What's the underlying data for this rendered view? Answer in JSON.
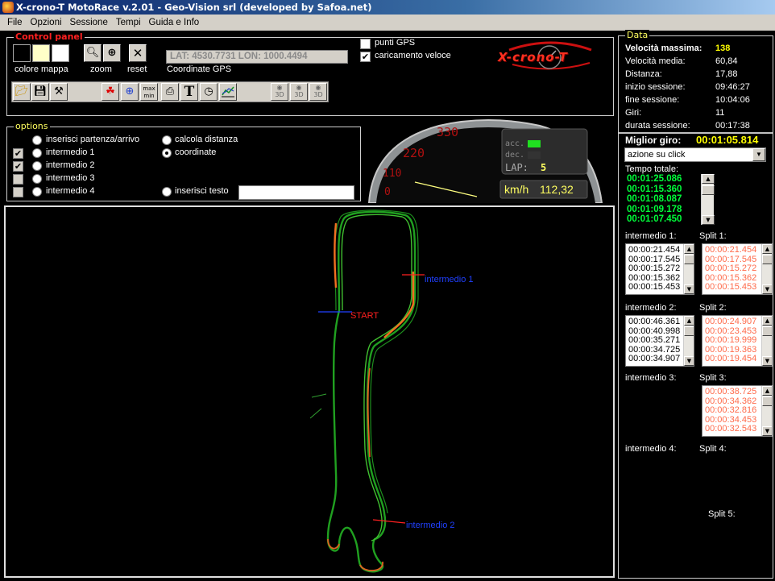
{
  "window": {
    "title": "X-crono-T MotoRace v.2.01 - Geo-Vision srl (developed by Safoa.net)"
  },
  "menu": [
    "File",
    "Opzioni",
    "Sessione",
    "Tempi",
    "Guida e Info"
  ],
  "control_panel": {
    "title": "Control panel",
    "colore_mappa_label": "colore mappa",
    "zoom_label": "zoom",
    "reset_label": "reset",
    "gps_coords": "LAT: 4530.7731 LON: 1000.4494",
    "gps_label": "Coordinate GPS",
    "punti_gps": {
      "label": "punti GPS",
      "checked": false
    },
    "caricamento_veloce": {
      "label": "caricamento veloce",
      "checked": true
    },
    "logo_text": "X-crono-T",
    "toolbar_icons": [
      "open-folder-icon",
      "save-icon",
      "tools-icon",
      "track-icon",
      "target-icon",
      "max-min-icon",
      "print-icon",
      "text-icon",
      "stopwatch-icon",
      "chart-icon",
      "view-3d-icon",
      "view-3d-icon",
      "view-3d-icon"
    ],
    "maxmin_top": "max",
    "maxmin_bottom": "min",
    "text_glyph": "T",
    "three_d": "3D",
    "colors": {
      "swatch1": "#000000",
      "swatch2": "#ffffc8",
      "swatch3": "#ffffff",
      "title": "#ff0000"
    }
  },
  "options": {
    "title": "options",
    "items": [
      {
        "label": "inserisci partenza/arrivo",
        "checkbox": false,
        "radio": false
      },
      {
        "label": "intermedio 1",
        "checkbox": true,
        "radio": false
      },
      {
        "label": "intermedio 2",
        "checkbox": true,
        "radio": false
      },
      {
        "label": "intermedio 3",
        "checkbox": false,
        "radio": false
      },
      {
        "label": "intermedio 4",
        "checkbox": false,
        "radio": false
      }
    ],
    "calcola_distanza": "calcola distanza",
    "coordinate": "coordinate",
    "inserisci_testo": "inserisci testo",
    "testo_value": ""
  },
  "dashboard": {
    "scale_labels": [
      "330",
      "220",
      "110",
      "0"
    ],
    "acc_label": "acc.",
    "dec_label": "dec.",
    "lap_label": "LAP:",
    "lap_value": "5",
    "speed_label": "km/h",
    "speed_value": "112,32"
  },
  "map": {
    "start_label": "START",
    "intermedio1_label": "intermedio 1",
    "intermedio2_label": "intermedio 2"
  },
  "data": {
    "title": "Data",
    "velocita_massima_label": "Velocità massima:",
    "velocita_massima": "138",
    "stats": [
      {
        "label": "Velocità media:",
        "value": "60,84"
      },
      {
        "label": "Distanza:",
        "value": "17,88"
      },
      {
        "label": "inizio sessione:",
        "value": "09:46:27"
      },
      {
        "label": "fine sessione:",
        "value": "10:04:06"
      },
      {
        "label": "Giri:",
        "value": "11"
      },
      {
        "label": "durata sessione:",
        "value": "00:17:38"
      }
    ],
    "miglior_giro_label": "Miglior giro:",
    "miglior_giro": "00:01:05.814",
    "azione": "azione su click",
    "tempo_totale_label": "Tempo totale:",
    "tempo_totale": [
      "00:01:25.086",
      "00:01:15.360",
      "00:01:08.087",
      "00:01:09.178",
      "00:01:07.450"
    ],
    "intermedio1_label": "intermedio 1:",
    "intermedio1": [
      "00:00:21.454",
      "00:00:17.545",
      "00:00:15.272",
      "00:00:15.362",
      "00:00:15.453"
    ],
    "split1_label": "Split 1:",
    "split1": [
      "00:00:21.454",
      "00:00:17.545",
      "00:00:15.272",
      "00:00:15.362",
      "00:00:15.453"
    ],
    "intermedio2_label": "intermedio 2:",
    "intermedio2": [
      "00:00:46.361",
      "00:00:40.998",
      "00:00:35.271",
      "00:00:34.725",
      "00:00:34.907"
    ],
    "split2_label": "Split 2:",
    "split2": [
      "00:00:24.907",
      "00:00:23.453",
      "00:00:19.999",
      "00:00:19.363",
      "00:00:19.454"
    ],
    "intermedio3_label": "intermedio 3:",
    "split3_label": "Split 3:",
    "split3": [
      "00:00:38.725",
      "00:00:34.362",
      "00:00:32.816",
      "00:00:34.453",
      "00:00:32.543"
    ],
    "intermedio4_label": "intermedio 4:",
    "split4_label": "Split 4:",
    "split5_label": "Split 5:",
    "colors": {
      "velocita": "#ffff00",
      "tempo": "#00ff3a",
      "split": "#ff6a4a"
    }
  }
}
